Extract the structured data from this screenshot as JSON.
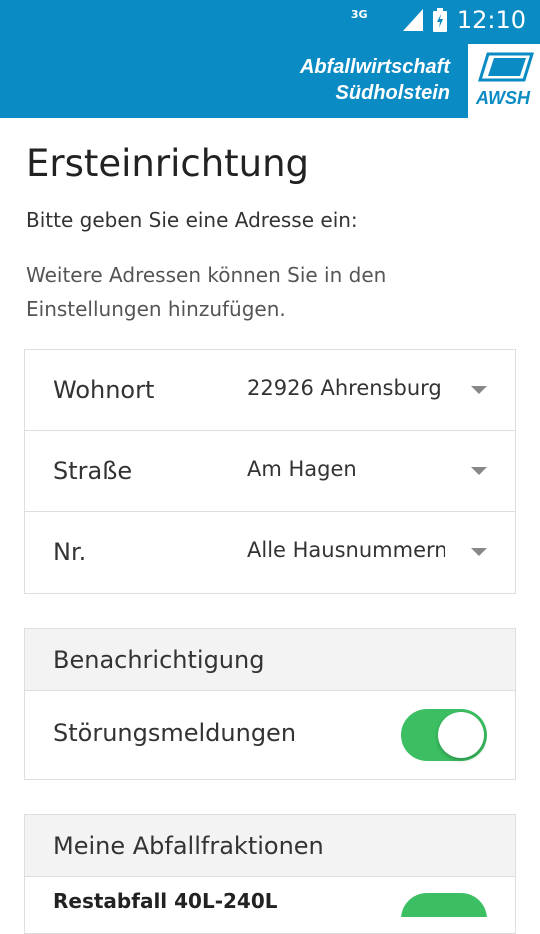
{
  "status_bar": {
    "network": "3G",
    "time": "12:10"
  },
  "header": {
    "brand_line1": "Abfallwirtschaft",
    "brand_line2": "Südholstein",
    "logo_text": "AWSH",
    "accent_color": "#0b8bc4"
  },
  "page": {
    "title": "Ersteinrichtung",
    "intro": "Bitte geben Sie eine Adresse ein:",
    "hint": "Weitere Adressen können Sie in den Einstellungen hinzufügen."
  },
  "address": {
    "rows": [
      {
        "label": "Wohnort",
        "value": "22926 Ahrensburg"
      },
      {
        "label": "Straße",
        "value": "Am Hagen"
      },
      {
        "label": "Nr.",
        "value": "Alle Hausnummern"
      }
    ]
  },
  "notification": {
    "heading": "Benachrichtigung",
    "toggle_label": "Störungsmeldungen",
    "toggle_on": true,
    "toggle_color": "#3bbf62"
  },
  "fractions": {
    "heading": "Meine Abfallfraktionen",
    "first_item": "Restabfall 40L-240L"
  }
}
